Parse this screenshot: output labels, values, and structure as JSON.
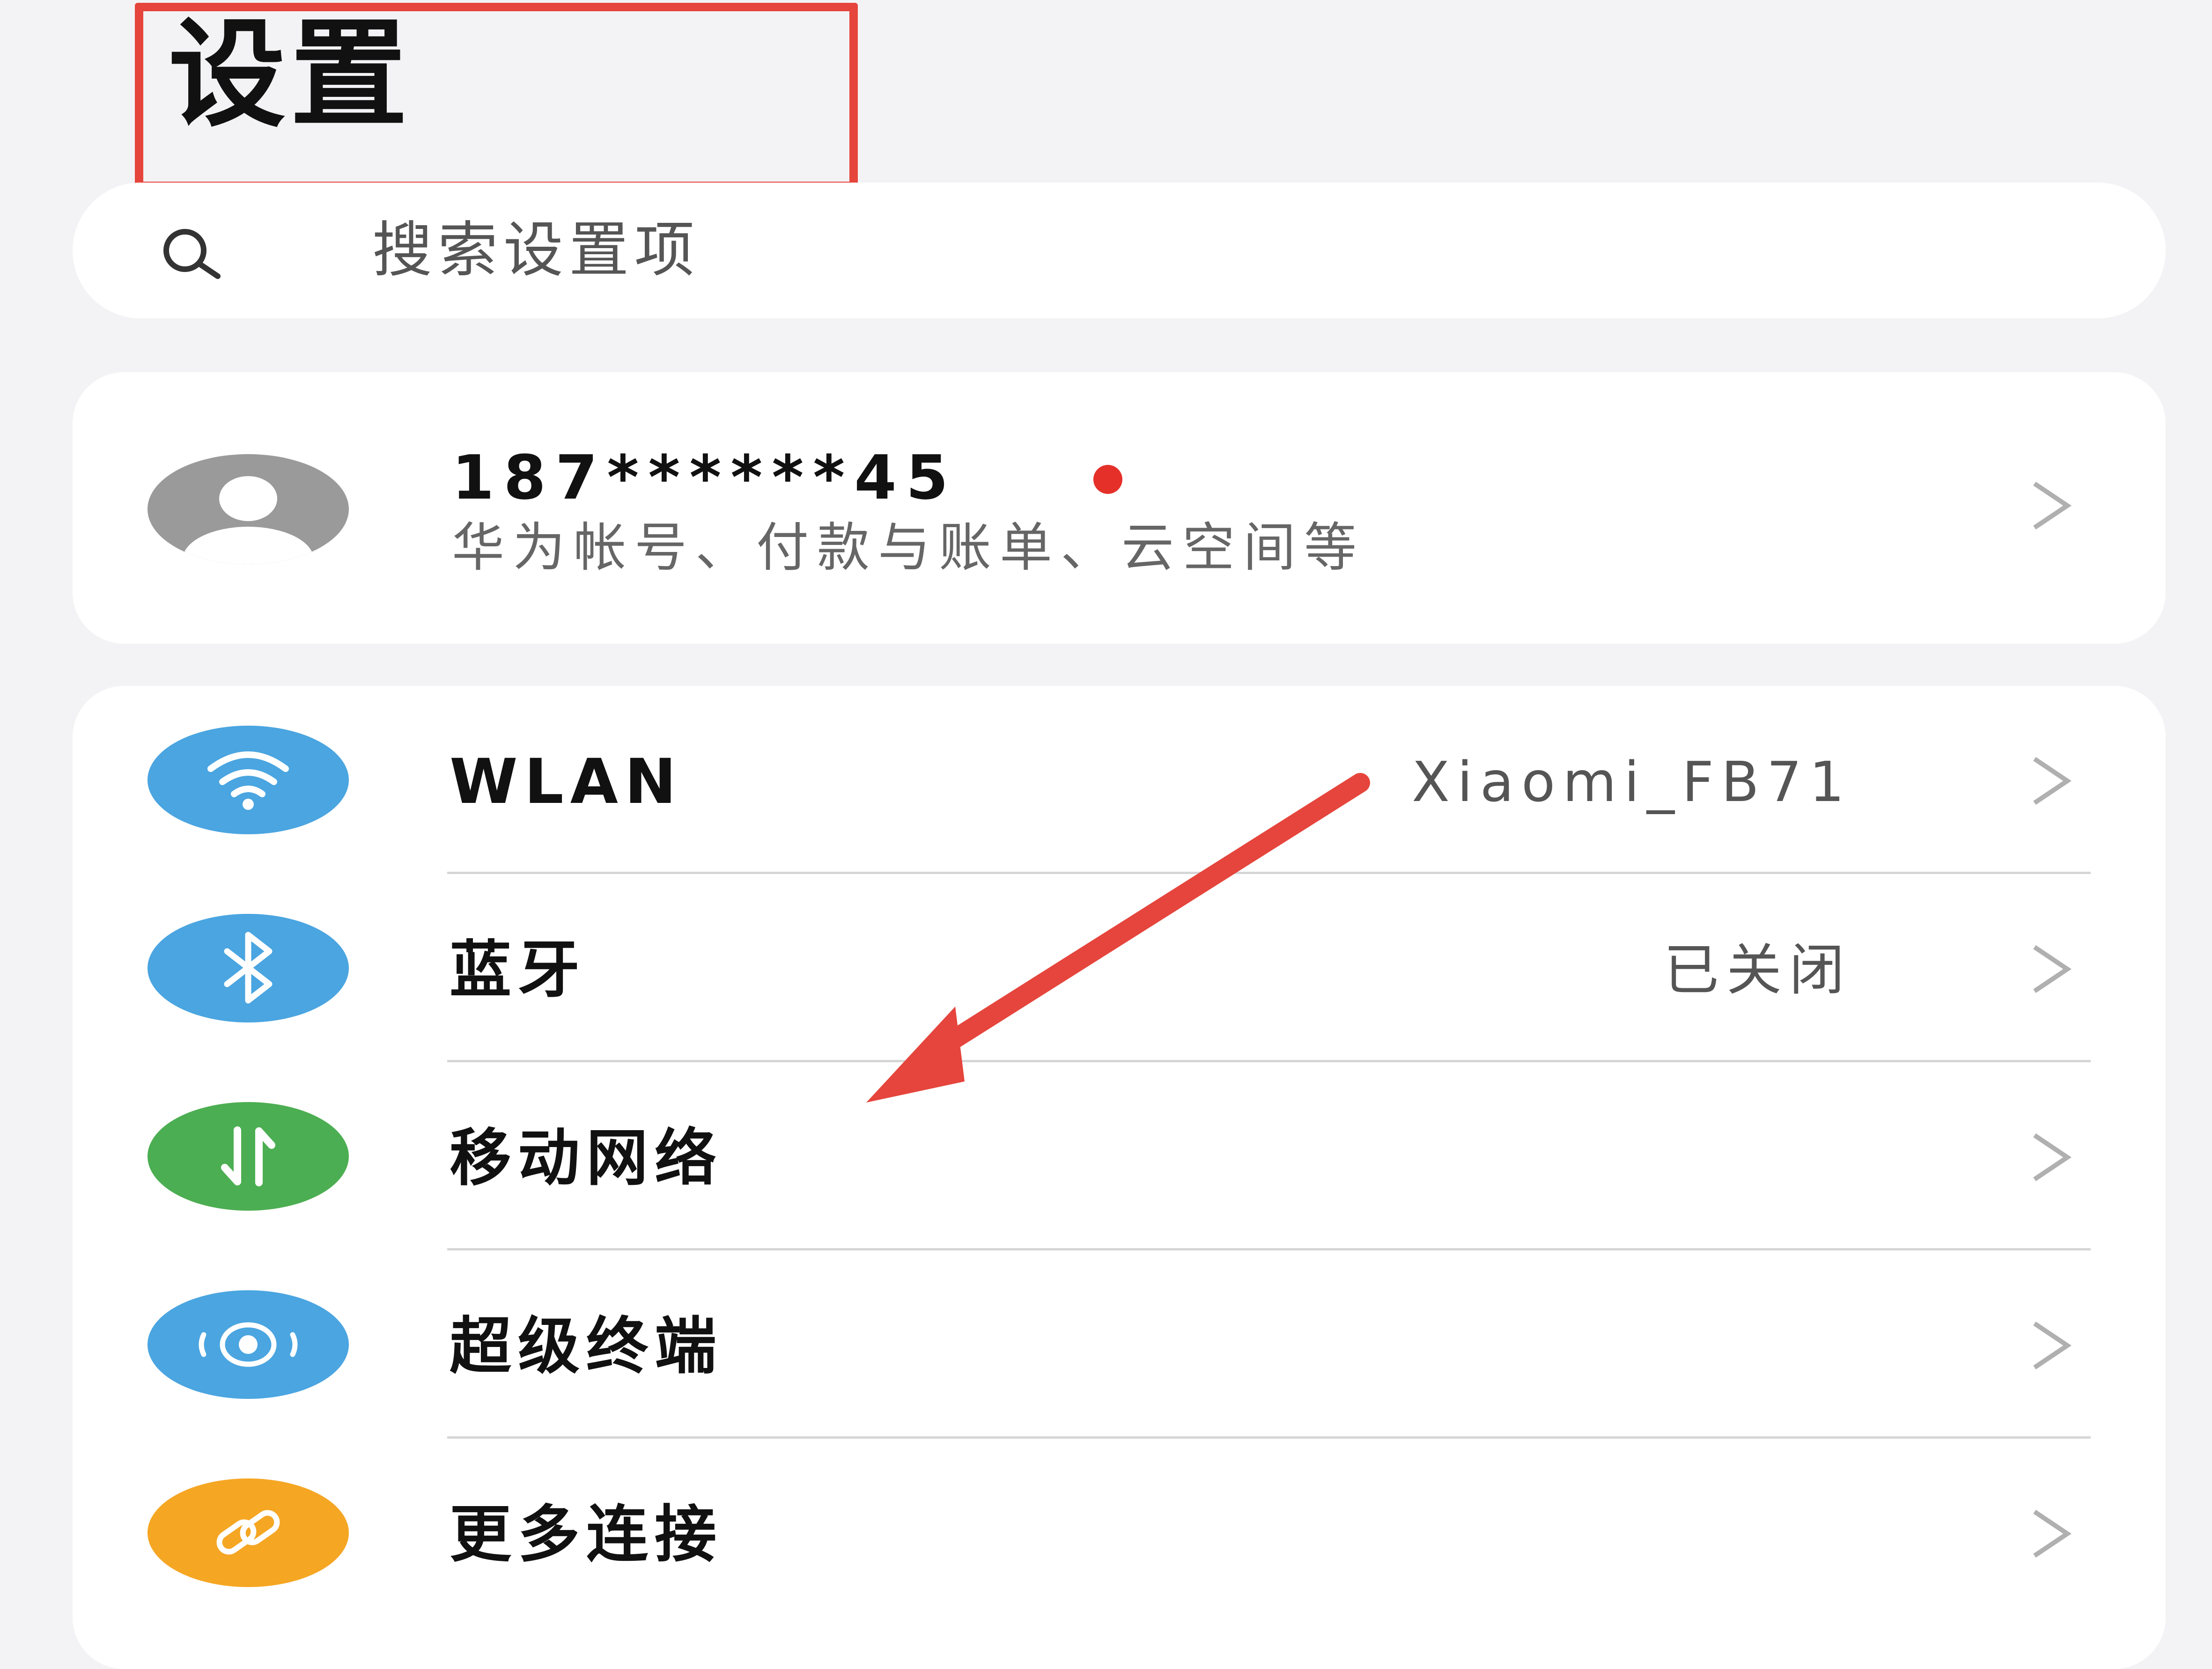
{
  "header": {
    "title": "设置"
  },
  "search": {
    "placeholder": "搜索设置项",
    "icon": "search-icon"
  },
  "account": {
    "name": "187******45",
    "subtitle": "华为帐号、付款与账单、云空间等",
    "has_notification_dot": true
  },
  "connections": [
    {
      "label": "WLAN",
      "value": "Xiaomi_FB71",
      "icon": "wifi-icon",
      "color": "#4aa5e0"
    },
    {
      "label": "蓝牙",
      "value": "已关闭",
      "icon": "bluetooth-icon",
      "color": "#4aa5e0"
    },
    {
      "label": "移动网络",
      "value": "",
      "icon": "mobile-data-icon",
      "color": "#4cae52"
    },
    {
      "label": "超级终端",
      "value": "",
      "icon": "super-device-icon",
      "color": "#4aa5e0"
    },
    {
      "label": "更多连接",
      "value": "",
      "icon": "link-icon",
      "color": "#f5a623"
    }
  ],
  "annotation": {
    "highlight_color": "#e5453c",
    "arrow_color": "#e5453c"
  }
}
